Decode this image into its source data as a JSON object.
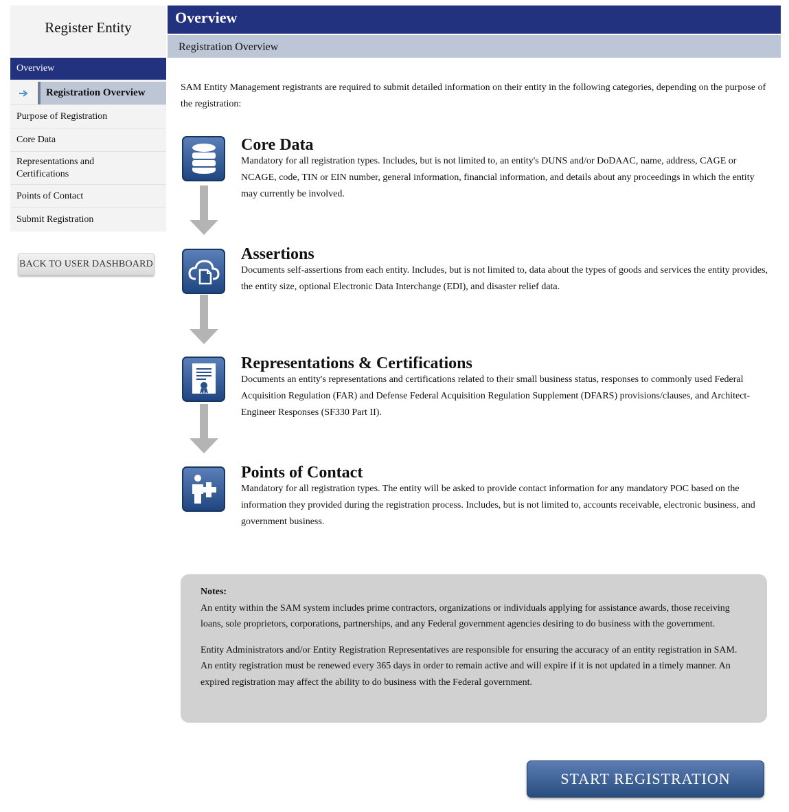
{
  "sidebar": {
    "title": "Register Entity",
    "items": [
      {
        "label": "Overview"
      },
      {
        "label": "Registration Overview"
      },
      {
        "label": "Purpose of Registration"
      },
      {
        "label": "Core Data"
      },
      {
        "label": "Representations and Certifications"
      },
      {
        "label": "Points of Contact"
      },
      {
        "label": "Submit Registration"
      }
    ],
    "back_button": "BACK TO USER DASHBOARD"
  },
  "header": {
    "title": "Overview",
    "subtitle": "Registration Overview"
  },
  "main": {
    "intro": "SAM Entity Management registrants are required to submit detailed information on their entity in the following categories, depending on the purpose of the registration:",
    "steps": [
      {
        "title": "Core Data",
        "icon": "database-icon",
        "description": "Mandatory for all registration types. Includes, but is not limited to, an entity's DUNS and/or DoDAAC, name, address, CAGE or NCAGE, code, TIN or EIN number, general information, financial information, and details about any proceedings in which the entity may currently be involved."
      },
      {
        "title": "Assertions",
        "icon": "cloud-document-icon",
        "description": "Documents self-assertions from each entity. Includes, but is not limited to, data about the types of goods and services the entity provides, the entity size, optional Electronic Data Interchange (EDI), and disaster relief data."
      },
      {
        "title": "Representations & Certifications",
        "icon": "certificate-icon",
        "description": "Documents an entity's representations and certifications related to their small business status, responses to commonly used Federal Acquisition Regulation (FAR) and Defense Federal Acquisition Regulation Supplement (DFARS) provisions/clauses, and Architect-Engineer Responses (SF330 Part II)."
      },
      {
        "title": "Points of Contact",
        "icon": "add-person-icon",
        "description": "Mandatory for all registration types. The entity will be asked to provide contact information for any mandatory POC based on the information they provided during the registration process. Includes, but is not limited to, accounts receivable, electronic business, and government business."
      }
    ],
    "notes": {
      "title": "Notes:",
      "paragraphs": [
        "An entity within the SAM system includes prime contractors, organizations or individuals applying for assistance awards, those receiving loans, sole proprietors, corporations, partnerships, and any Federal government agencies desiring to do business with the government.",
        "Entity Administrators and/or Entity Registration Representatives are responsible for ensuring the accuracy of an entity registration in SAM. An entity registration must be renewed every 365 days in order to remain active and will expire if it is not updated in a timely manner. An expired registration may affect the ability to do business with the Federal government."
      ]
    },
    "start_button": "START REGISTRATION"
  },
  "colors": {
    "nav_active": "#23327f",
    "sub_bar": "#bdc6d6",
    "icon_blue": "#1f4680",
    "notes_bg": "#d1d1d1"
  }
}
